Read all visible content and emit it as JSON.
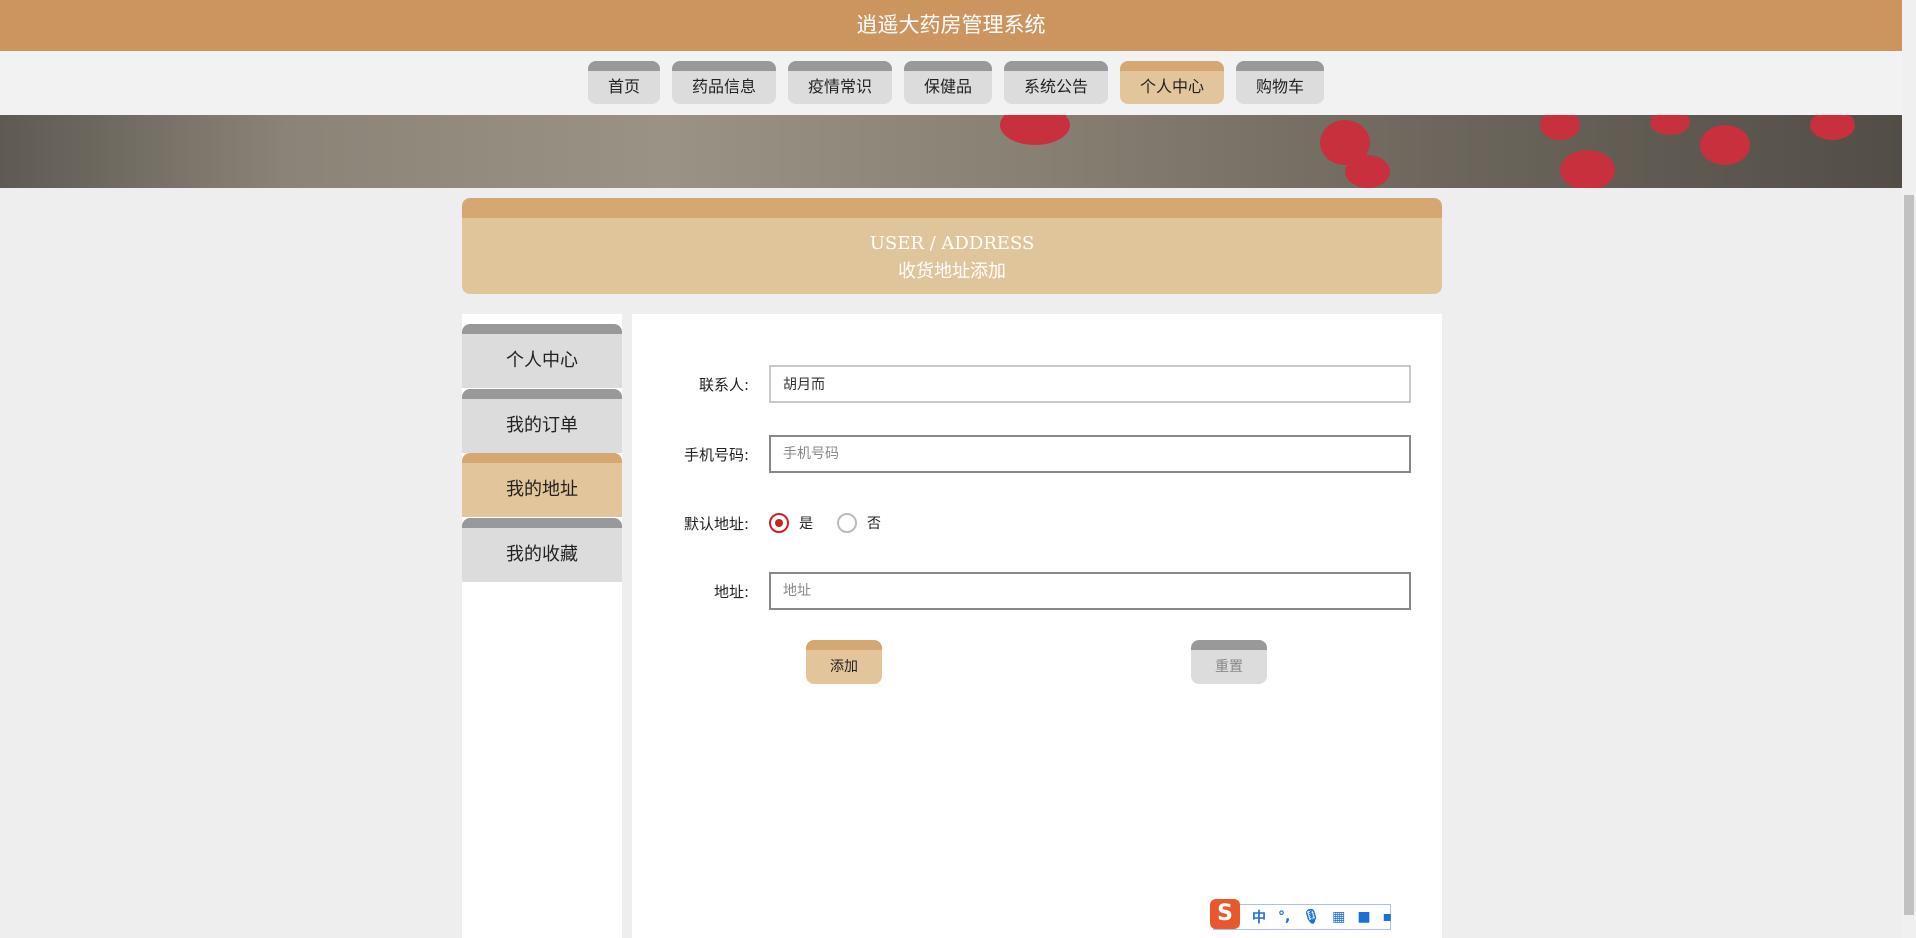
{
  "header": {
    "title": "逍遥大药房管理系统"
  },
  "nav": {
    "tabs": [
      {
        "label": "首页"
      },
      {
        "label": "药品信息"
      },
      {
        "label": "疫情常识"
      },
      {
        "label": "保健品"
      },
      {
        "label": "系统公告"
      },
      {
        "label": "个人中心",
        "active": true
      },
      {
        "label": "购物车"
      }
    ]
  },
  "section": {
    "title_en": "USER / ADDRESS",
    "title_cn": "收货地址添加"
  },
  "sidebar": {
    "items": [
      {
        "label": "个人中心"
      },
      {
        "label": "我的订单"
      },
      {
        "label": "我的地址",
        "active": true
      },
      {
        "label": "我的收藏"
      }
    ]
  },
  "form": {
    "contact": {
      "label": "联系人:",
      "value": "胡月而"
    },
    "phone": {
      "label": "手机号码:",
      "placeholder": "手机号码"
    },
    "default": {
      "label": "默认地址:",
      "yes": "是",
      "no": "否",
      "selected": "是"
    },
    "address": {
      "label": "地址:",
      "placeholder": "地址"
    },
    "add_label": "添加",
    "reset_label": "重置"
  },
  "ime": {
    "logo": "S",
    "mode": "中",
    "punct": "°,"
  }
}
